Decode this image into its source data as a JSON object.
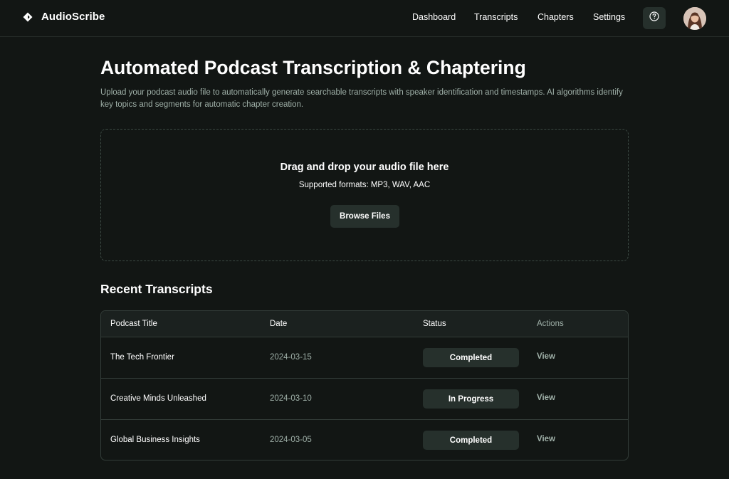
{
  "brand": {
    "name": "AudioScribe"
  },
  "nav": [
    {
      "label": "Dashboard"
    },
    {
      "label": "Transcripts"
    },
    {
      "label": "Chapters"
    },
    {
      "label": "Settings"
    }
  ],
  "header": {
    "help_icon": "question-circle-icon",
    "avatar_icon": "user-avatar"
  },
  "main": {
    "title": "Automated Podcast Transcription & Chaptering",
    "description": "Upload your podcast audio file to automatically generate searchable transcripts with speaker identification and timestamps. AI algorithms identify key topics and segments for automatic chapter creation."
  },
  "upload": {
    "title": "Drag and drop your audio file here",
    "formats": "Supported formats: MP3, WAV, AAC",
    "button": "Browse Files"
  },
  "recent": {
    "title": "Recent Transcripts",
    "columns": [
      "Podcast Title",
      "Date",
      "Status",
      "Actions"
    ],
    "rows": [
      {
        "title": "The Tech Frontier",
        "date": "2024-03-15",
        "status": "Completed",
        "action": "View"
      },
      {
        "title": "Creative Minds Unleashed",
        "date": "2024-03-10",
        "status": "In Progress",
        "action": "View"
      },
      {
        "title": "Global Business Insights",
        "date": "2024-03-05",
        "status": "Completed",
        "action": "View"
      }
    ]
  },
  "colors": {
    "background": "#121614",
    "surface": "#26302c",
    "muted_text": "#9fb0a8",
    "border": "#333d39"
  }
}
